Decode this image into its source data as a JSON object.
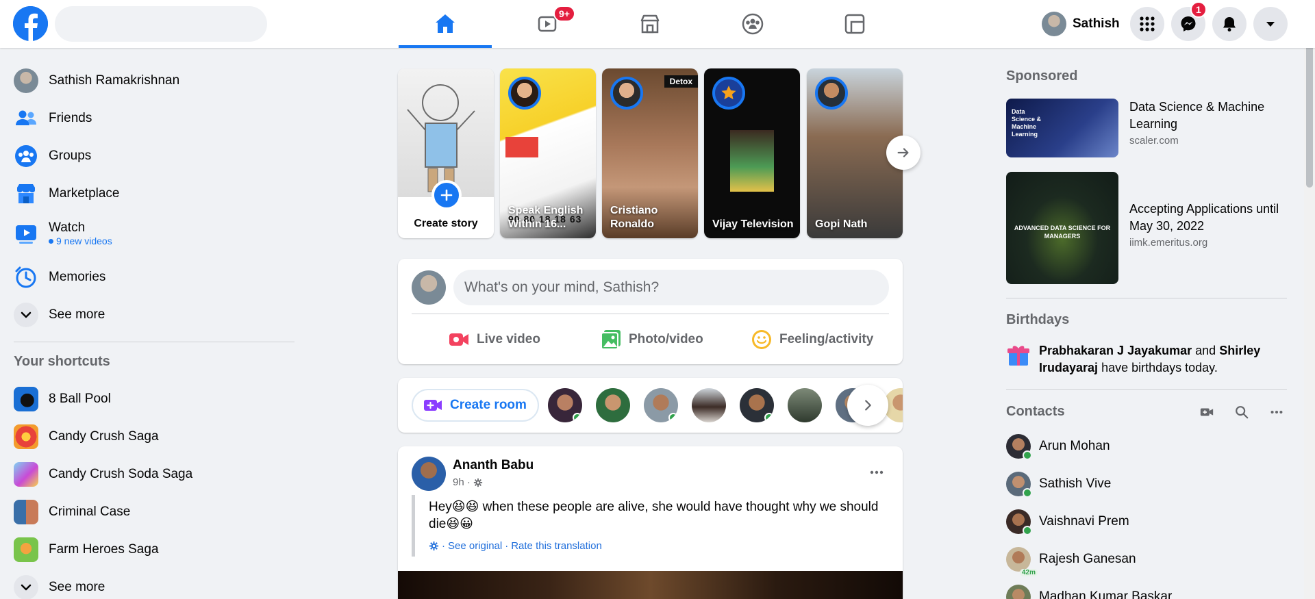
{
  "topbar": {
    "search_placeholder": "",
    "profile_name": "Sathish",
    "watch_badge": "9+",
    "messenger_badge": "1",
    "nav": [
      "Home",
      "Watch",
      "Marketplace",
      "Groups",
      "Gaming"
    ]
  },
  "sidebar": {
    "items": [
      {
        "label": "Sathish Ramakrishnan"
      },
      {
        "label": "Friends"
      },
      {
        "label": "Groups"
      },
      {
        "label": "Marketplace"
      },
      {
        "label": "Watch",
        "sub": "9 new videos"
      },
      {
        "label": "Memories"
      },
      {
        "label": "See more"
      }
    ],
    "shortcuts_title": "Your shortcuts",
    "shortcuts": [
      {
        "label": "8 Ball Pool"
      },
      {
        "label": "Candy Crush Saga"
      },
      {
        "label": "Candy Crush Soda Saga"
      },
      {
        "label": "Criminal Case"
      },
      {
        "label": "Farm Heroes Saga"
      },
      {
        "label": "See more"
      }
    ]
  },
  "stories": {
    "create_label": "Create story",
    "items": [
      {
        "name": "Speak English Within 16...",
        "overlay": "90 80 18 18 63"
      },
      {
        "name": "Cristiano Ronaldo",
        "tag": "Detox"
      },
      {
        "name": "Vijay Television"
      },
      {
        "name": "Gopi Nath"
      }
    ]
  },
  "composer": {
    "placeholder": "What's on your mind, Sathish?",
    "actions": [
      {
        "label": "Live video",
        "color": "#f3425f"
      },
      {
        "label": "Photo/video",
        "color": "#45bd62"
      },
      {
        "label": "Feeling/activity",
        "color": "#f7b928"
      }
    ]
  },
  "rooms": {
    "create_label": "Create room"
  },
  "post": {
    "author": "Ananth Babu",
    "time": "9h ·",
    "text": "Hey😆😆 when these people are alive, she would have thought why we should die😆😀",
    "see_original": "See original",
    "rate_translation": "Rate this translation",
    "sep": "·"
  },
  "right": {
    "sponsored_title": "Sponsored",
    "ads": [
      {
        "title": "Data Science & Machine Learning",
        "domain": "scaler.com",
        "thumb_title": "Data Science & Machine Learning"
      },
      {
        "title": "Accepting Applications until May 30, 2022",
        "domain": "iimk.emeritus.org",
        "thumb_title": "ADVANCED DATA SCIENCE FOR MANAGERS"
      }
    ],
    "birthdays_title": "Birthdays",
    "birthday": {
      "name1": "Prabhakaran J Jayakumar",
      "and": "and",
      "name2": "Shirley Irudayaraj",
      "rest": "have birthdays today."
    },
    "contacts_title": "Contacts",
    "contacts": [
      {
        "name": "Arun Mohan",
        "online": true
      },
      {
        "name": "Sathish Vive",
        "online": true
      },
      {
        "name": "Vaishnavi Prem",
        "online": true
      },
      {
        "name": "Rajesh Ganesan",
        "mins": "42m"
      },
      {
        "name": "Madhan Kumar Baskar"
      }
    ]
  },
  "colors": {
    "brand": "#1877f2",
    "bg": "#f0f2f5",
    "badge": "#e41e3f",
    "online": "#31a24c"
  }
}
